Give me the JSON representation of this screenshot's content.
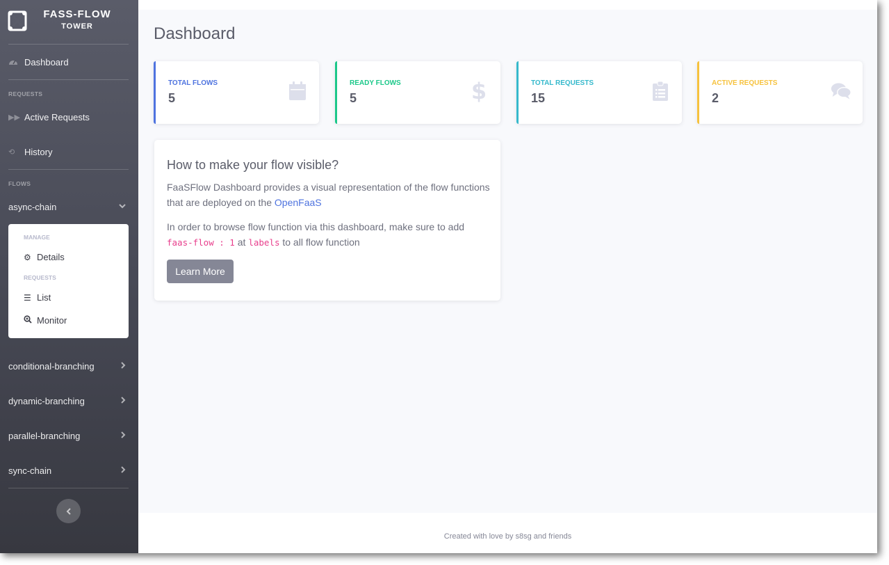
{
  "brand": {
    "line1": "FASS-FLOW",
    "line2": "TOWER"
  },
  "sidebar": {
    "dashboard_label": "Dashboard",
    "requests_heading": "REQUESTS",
    "active_requests_label": "Active Requests",
    "history_label": "History",
    "flows_heading": "FLOWS",
    "flows": [
      {
        "label": "async-chain",
        "expanded": true
      },
      {
        "label": "conditional-branching",
        "expanded": false
      },
      {
        "label": "dynamic-branching",
        "expanded": false
      },
      {
        "label": "parallel-branching",
        "expanded": false
      },
      {
        "label": "sync-chain",
        "expanded": false
      }
    ],
    "submenu": {
      "manage_heading": "MANAGE",
      "details_label": "Details",
      "requests_heading": "REQUESTS",
      "list_label": "List",
      "monitor_label": "Monitor"
    },
    "toggle_icon": "chevron-left-icon"
  },
  "page": {
    "title": "Dashboard"
  },
  "cards": [
    {
      "label": "TOTAL FLOWS",
      "value": "5",
      "color": "#4e73df",
      "icon": "calendar-icon"
    },
    {
      "label": "READY FLOWS",
      "value": "5",
      "color": "#1cc88a",
      "icon": "dollar-icon"
    },
    {
      "label": "TOTAL REQUESTS",
      "value": "15",
      "color": "#36b9cc",
      "icon": "clipboard-list-icon"
    },
    {
      "label": "ACTIVE REQUESTS",
      "value": "2",
      "color": "#f6c23e",
      "icon": "comments-icon"
    }
  ],
  "info": {
    "title": "How to make your flow visible?",
    "p1_text": "FaaSFlow Dashboard provides a visual representation of the flow functions that are deployed on the ",
    "p1_link": "OpenFaaS",
    "p2_text": "In order to browse flow function via this dashboard, make sure to add",
    "p2_code1": "faas-flow : 1",
    "p2_at": " at ",
    "p2_code2": "labels",
    "p2_tail": " to all flow function",
    "button_label": "Learn More"
  },
  "footer": {
    "text": "Created with love by s8sg and friends"
  }
}
